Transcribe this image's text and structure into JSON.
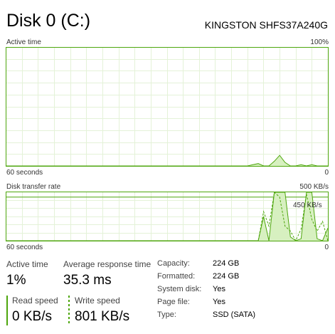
{
  "header": {
    "title": "Disk 0 (C:)",
    "model": "KINGSTON SHFS37A240G"
  },
  "active_chart": {
    "label_left": "Active time",
    "label_right": "100%",
    "footer_left": "60 seconds",
    "footer_right": "0"
  },
  "transfer_chart": {
    "label_left": "Disk transfer rate",
    "label_right": "500 KB/s",
    "inner_label": "450 KB/s",
    "footer_left": "60 seconds",
    "footer_right": "0"
  },
  "stats": {
    "active_time_label": "Active time",
    "active_time_value": "1%",
    "avg_response_label": "Average response time",
    "avg_response_value": "35.3 ms",
    "read_speed_label": "Read speed",
    "read_speed_value": "0 KB/s",
    "write_speed_label": "Write speed",
    "write_speed_value": "801 KB/s"
  },
  "properties": [
    {
      "label": "Capacity:",
      "value": "224 GB"
    },
    {
      "label": "Formatted:",
      "value": "224 GB"
    },
    {
      "label": "System disk:",
      "value": "Yes"
    },
    {
      "label": "Page file:",
      "value": "Yes"
    },
    {
      "label": "Type:",
      "value": "SSD (SATA)"
    }
  ],
  "colors": {
    "border": "#4da60c",
    "fill": "#d7f0c0",
    "grid": "#e4f2d8"
  },
  "chart_data": [
    {
      "type": "area",
      "title": "Active time",
      "xlabel": "60 seconds",
      "ylim": [
        0,
        100
      ],
      "x": [
        60,
        15,
        14,
        13,
        12,
        11,
        10,
        9,
        8,
        7,
        6,
        5,
        4,
        3,
        2,
        1,
        0
      ],
      "series": [
        {
          "values": [
            0,
            0,
            1,
            2,
            0,
            0,
            4,
            9,
            3,
            0,
            0,
            1,
            0,
            1,
            0,
            0,
            0
          ]
        }
      ]
    },
    {
      "type": "area",
      "title": "Disk transfer rate",
      "xlabel": "60 seconds",
      "ylim": [
        0,
        500
      ],
      "x": [
        60,
        13,
        12,
        11,
        10,
        9,
        8,
        7,
        6,
        5,
        4,
        3,
        2,
        1,
        0
      ],
      "series": [
        {
          "name": "Read speed",
          "values": [
            0,
            0,
            250,
            0,
            500,
            500,
            500,
            40,
            0,
            20,
            500,
            500,
            20,
            0,
            130
          ]
        },
        {
          "name": "Write speed",
          "values": [
            0,
            0,
            300,
            150,
            500,
            450,
            150,
            100,
            0,
            120,
            480,
            220,
            100,
            200,
            0
          ]
        }
      ]
    }
  ]
}
